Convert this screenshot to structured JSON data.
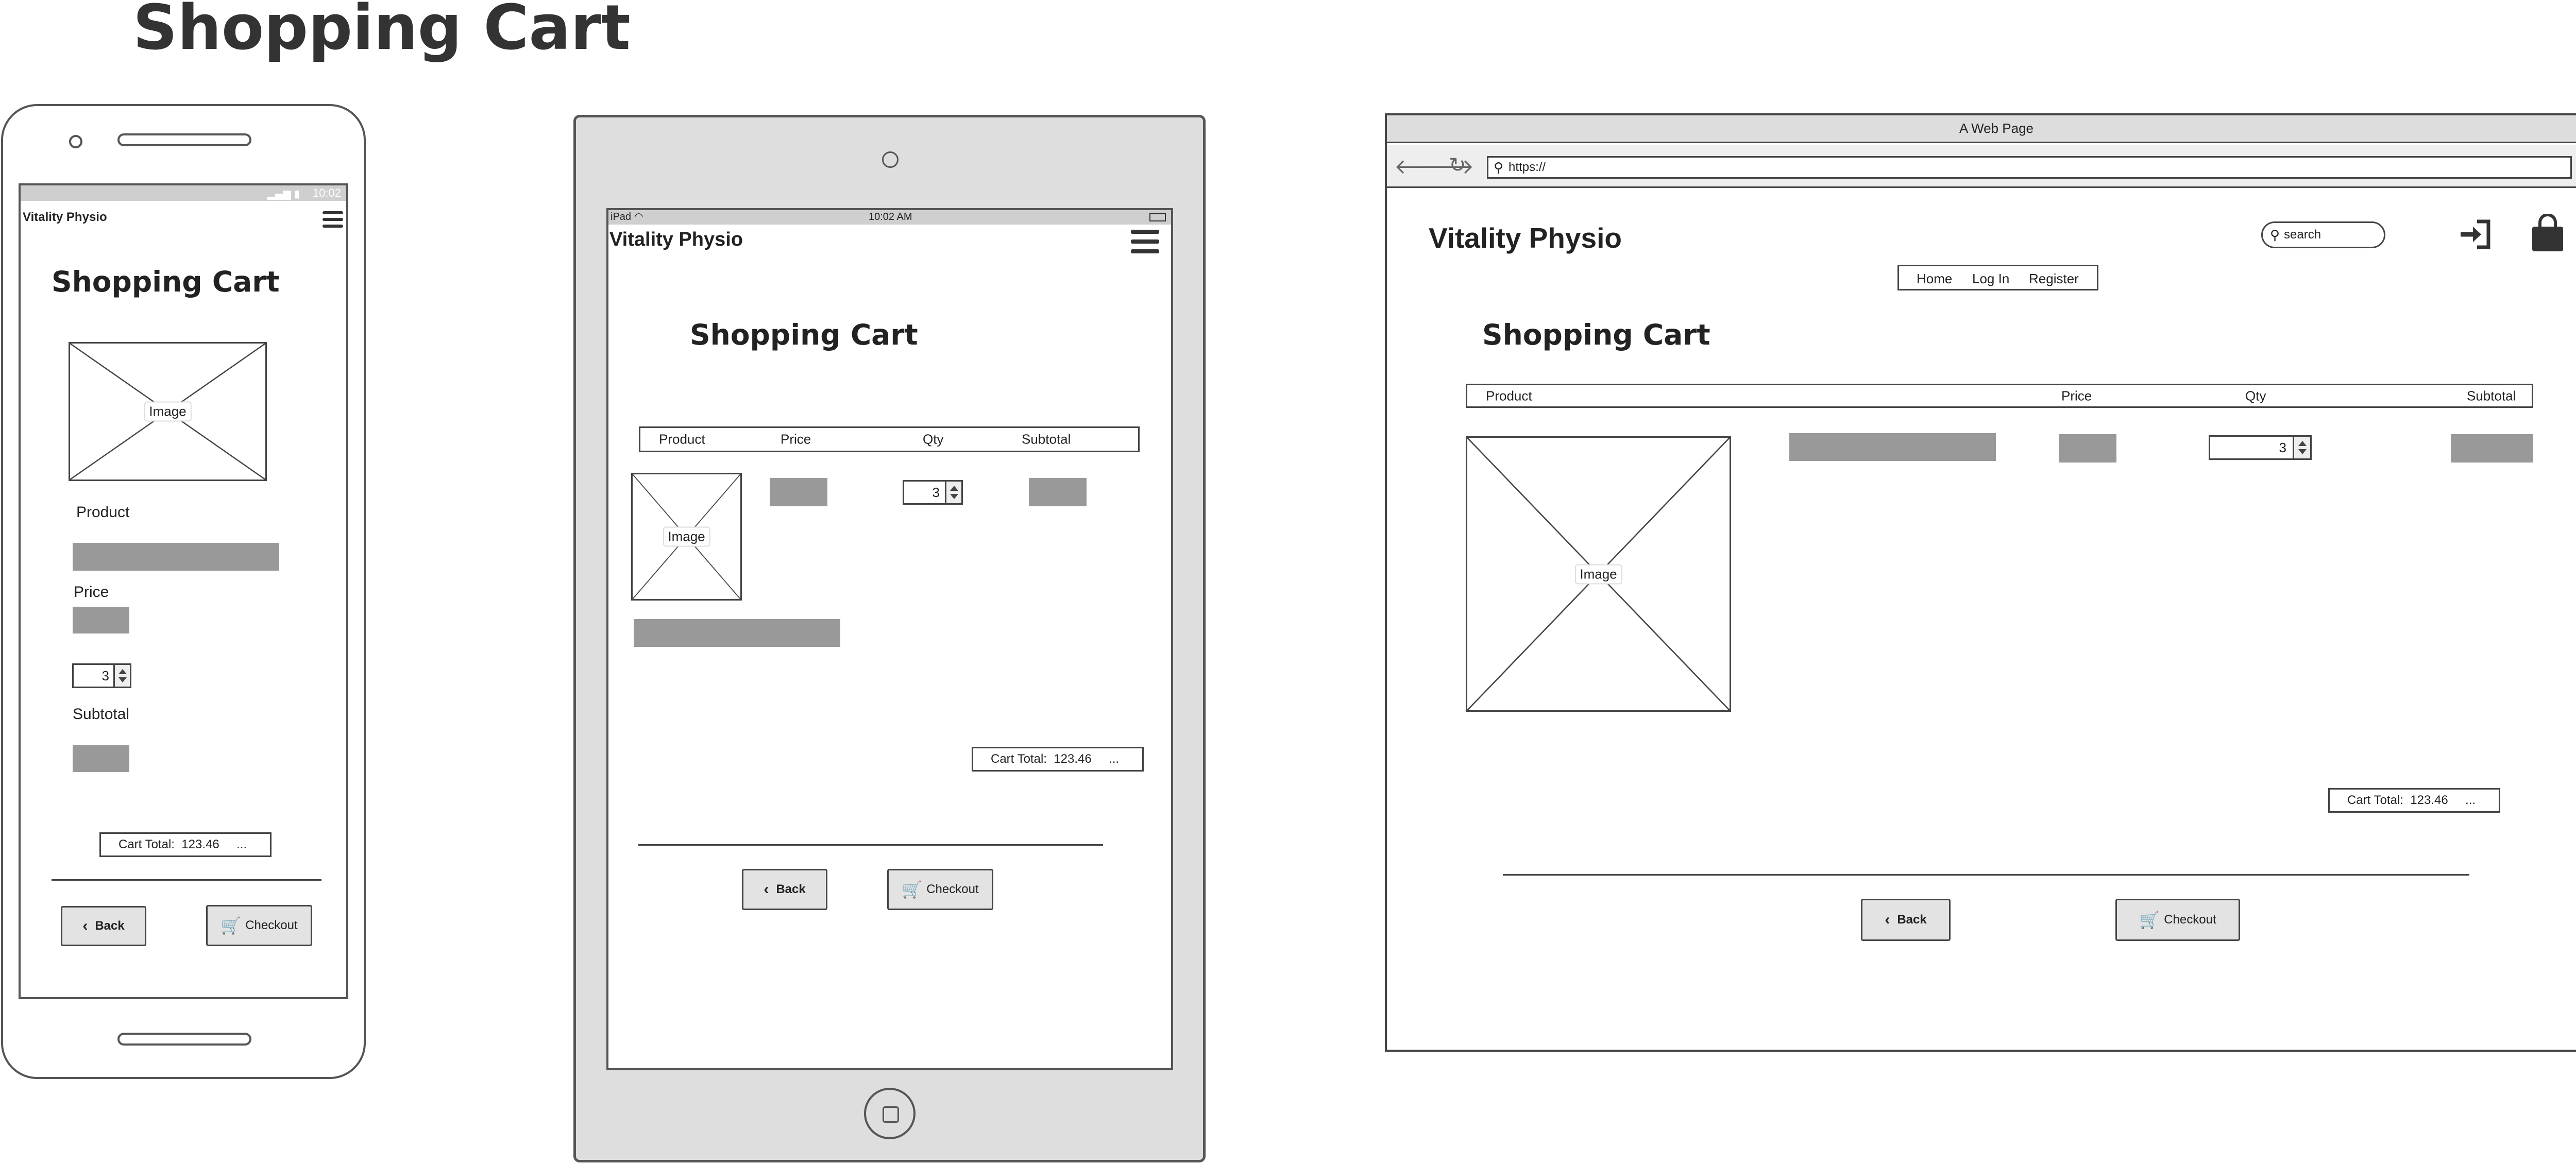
{
  "page_title": "Shopping Cart",
  "brand": "Vitality Physio",
  "cart": {
    "heading": "Shopping Cart",
    "columns": [
      "Product",
      "Price",
      "Qty",
      "Subtotal"
    ],
    "image_label": "Image",
    "qty": "3",
    "cart_total_label": "Cart Total:",
    "cart_total_value": "123.46",
    "cart_total_more": "...",
    "back_label": "Back",
    "checkout_label": "Checkout"
  },
  "mobile": {
    "status_time": "10:02",
    "product_label": "Product",
    "price_label": "Price",
    "subtotal_label": "Subtotal"
  },
  "tablet": {
    "status_device": "iPad",
    "status_time": "10:02 AM"
  },
  "desktop": {
    "window_title": "A Web Page",
    "url": "https://",
    "search_placeholder": "search",
    "nav": [
      "Home",
      "Log In",
      "Register"
    ]
  }
}
